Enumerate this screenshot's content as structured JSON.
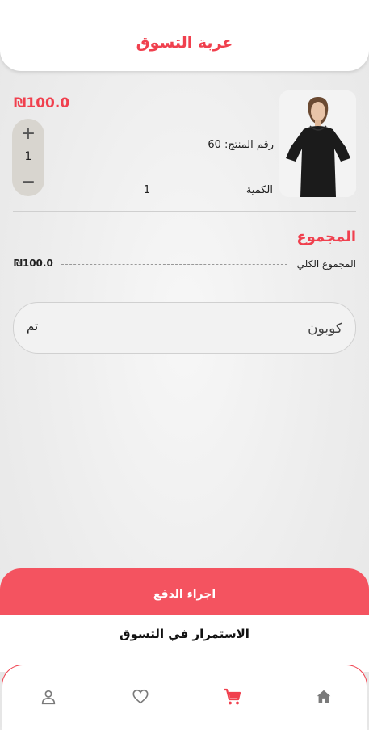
{
  "header": {
    "title": "عربة التسوق"
  },
  "cart_item": {
    "price": "₪100.0",
    "product_id_label": "رقم المنتج: 60",
    "quantity_label": "الكمية",
    "quantity_value": "1",
    "stepper": {
      "plus": "+",
      "value": "1",
      "minus": "−"
    }
  },
  "totals": {
    "title": "المجموع",
    "total_label": "المجموع الكلي",
    "total_value": "₪100.0"
  },
  "coupon": {
    "placeholder": "كوبون",
    "apply_label": "تم"
  },
  "checkout": {
    "label": "اجراء الدفع"
  },
  "continue_shopping": {
    "label": "الاستمرار في التسوق"
  },
  "bottom_nav": {
    "items": [
      {
        "icon": "home-icon",
        "active": false
      },
      {
        "icon": "cart-icon",
        "active": true
      },
      {
        "icon": "heart-icon",
        "active": false
      },
      {
        "icon": "user-icon",
        "active": false
      }
    ],
    "active_color": "#f0404e",
    "inactive_color": "#7a7a7a"
  },
  "colors": {
    "accent": "#f0404e",
    "checkout_bg": "#f45360"
  }
}
